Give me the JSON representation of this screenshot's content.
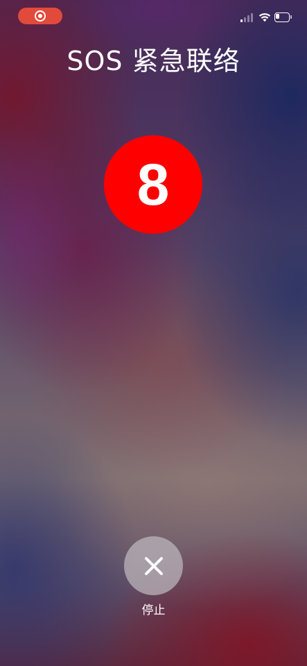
{
  "status_bar": {
    "recording_icon": "screen-record-icon",
    "signal_icon": "cellular-signal-icon",
    "signal_level": 0.25,
    "wifi_icon": "wifi-icon",
    "battery_icon": "battery-icon",
    "battery_level": 0.3,
    "record_color": "#e24a3b"
  },
  "title": "SOS 紧急联络",
  "countdown": {
    "value": "8",
    "color": "#ff0000"
  },
  "stop": {
    "icon": "close-icon",
    "label": "停止"
  }
}
